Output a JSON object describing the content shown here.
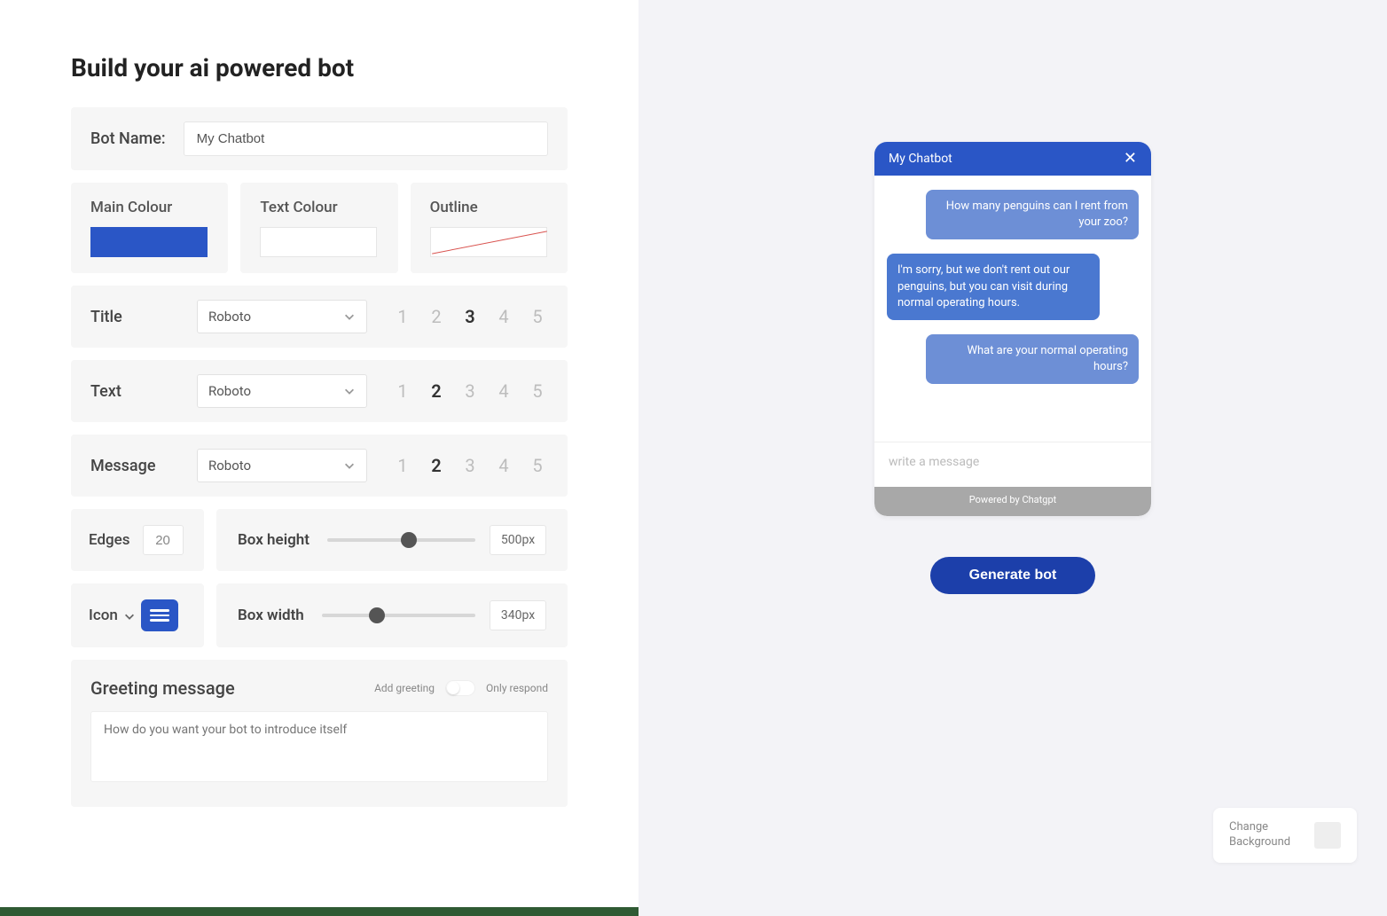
{
  "page_title": "Build your ai powered bot",
  "bot_name": {
    "label": "Bot Name:",
    "value": "My Chatbot"
  },
  "colors": {
    "main": {
      "label": "Main Colour",
      "value": "#2a56c6"
    },
    "text": {
      "label": "Text Colour",
      "value": "#ffffff"
    },
    "outline": {
      "label": "Outline",
      "value": "none"
    }
  },
  "fonts": {
    "title": {
      "label": "Title",
      "family": "Roboto",
      "size_selected": 3,
      "sizes": [
        "1",
        "2",
        "3",
        "4",
        "5"
      ]
    },
    "text": {
      "label": "Text",
      "family": "Roboto",
      "size_selected": 2,
      "sizes": [
        "1",
        "2",
        "3",
        "4",
        "5"
      ]
    },
    "message": {
      "label": "Message",
      "family": "Roboto",
      "size_selected": 2,
      "sizes": [
        "1",
        "2",
        "3",
        "4",
        "5"
      ]
    }
  },
  "edges": {
    "label": "Edges",
    "value": "20"
  },
  "box_height": {
    "label": "Box height",
    "value": "500px",
    "pct": 55
  },
  "icon": {
    "label": "Icon"
  },
  "box_width": {
    "label": "Box width",
    "value": "340px",
    "pct": 36
  },
  "greeting": {
    "title": "Greeting message",
    "left_label": "Add greeting",
    "right_label": "Only respond",
    "placeholder": "How do you want your bot to introduce itself"
  },
  "preview": {
    "header": "My Chatbot",
    "messages": [
      {
        "role": "user",
        "text": "How many penguins can I rent from your zoo?"
      },
      {
        "role": "bot",
        "text": "I'm sorry, but we don't rent out our penguins, but you can visit during normal operating hours."
      },
      {
        "role": "user",
        "text": "What are your normal operating hours?"
      }
    ],
    "input_placeholder": "write a message",
    "footer": "Powered by Chatgpt"
  },
  "generate_label": "Generate bot",
  "change_bg_label": "Change Background"
}
